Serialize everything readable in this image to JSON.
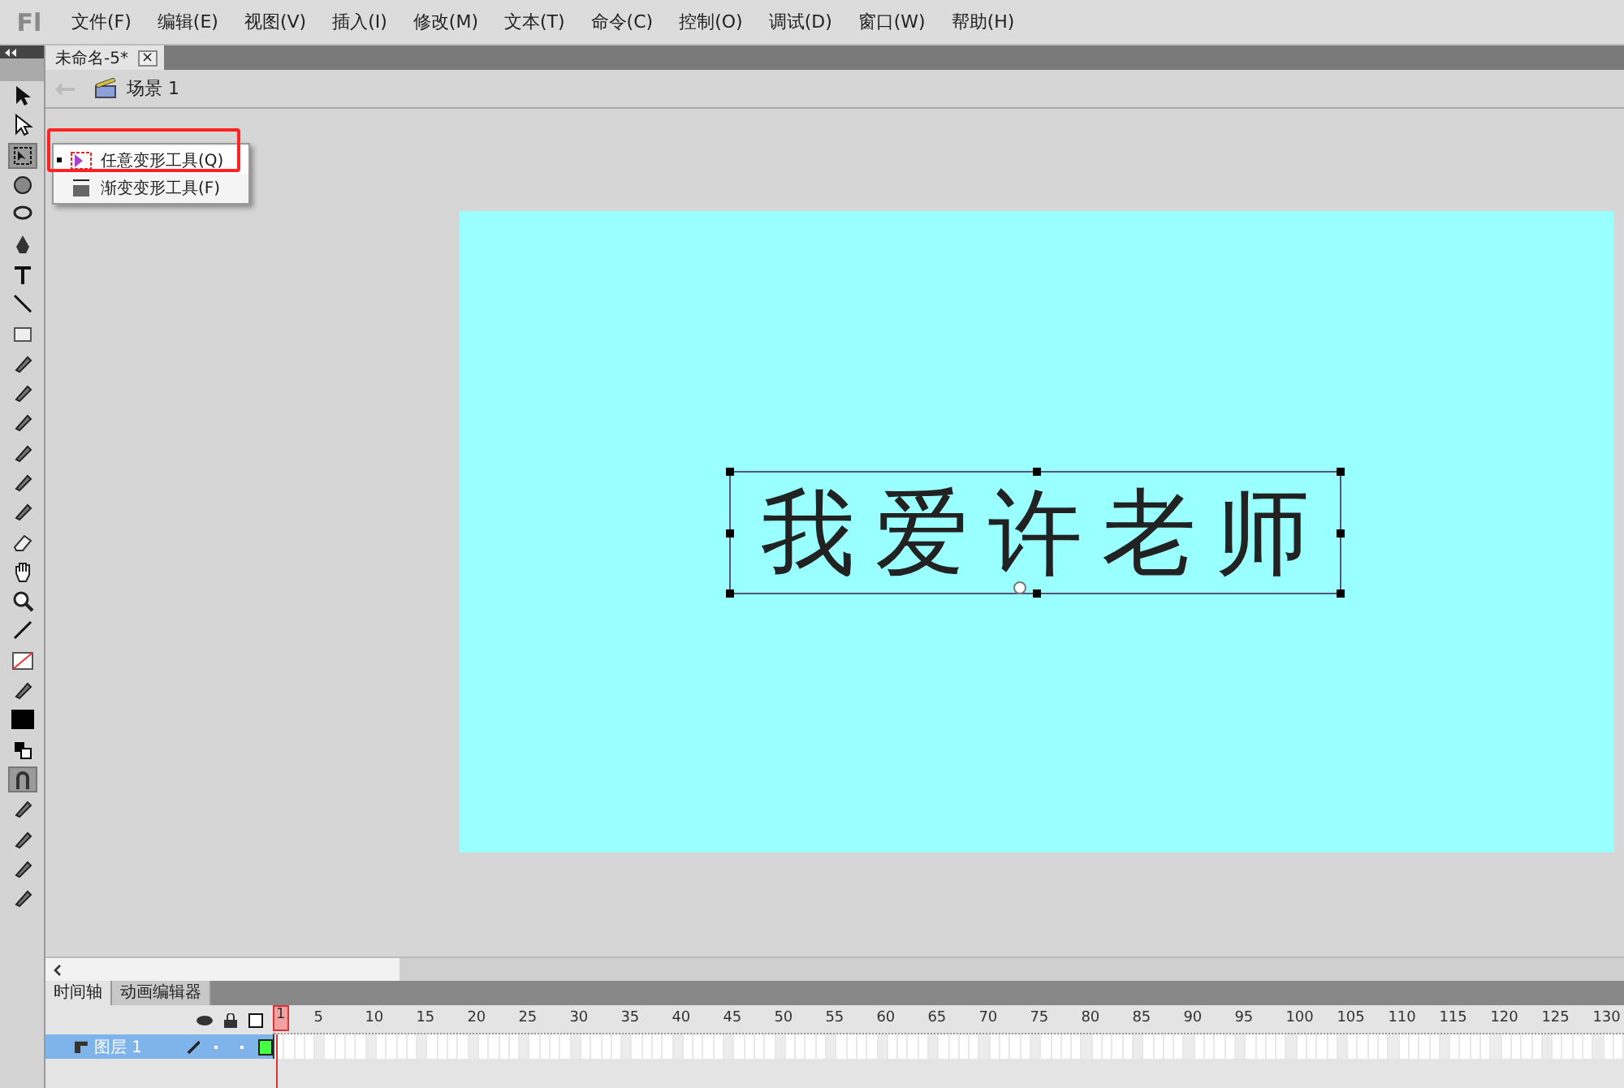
{
  "menu_bar": {
    "logo": "Fl",
    "items": [
      "文件(F)",
      "编辑(E)",
      "视图(V)",
      "插入(I)",
      "修改(M)",
      "文本(T)",
      "命令(C)",
      "控制(O)",
      "调试(D)",
      "窗口(W)",
      "帮助(H)"
    ]
  },
  "document_tab": {
    "title": "未命名-5*",
    "close": "×"
  },
  "breadcrumb": {
    "scene": "场景 1"
  },
  "tools": [
    {
      "selected": false
    },
    {
      "selected": false
    },
    {
      "selected": true
    },
    {
      "selected": false
    },
    {
      "selected": false
    },
    {
      "selected": false
    },
    {
      "selected": false
    },
    {
      "selected": false
    },
    {
      "selected": false
    },
    {
      "selected": false
    },
    {
      "selected": false
    },
    {
      "selected": false
    },
    {
      "selected": false
    },
    {
      "selected": false
    },
    {
      "selected": false
    },
    {
      "selected": false
    },
    {
      "selected": false
    },
    {
      "selected": false
    },
    {
      "selected": false
    },
    {
      "selected": false
    },
    {
      "selected": false
    },
    {
      "selected": false
    },
    {
      "selected": false
    },
    {
      "selected": true
    },
    {
      "selected": false
    },
    {
      "selected": false
    },
    {
      "selected": false
    },
    {
      "selected": false
    }
  ],
  "tool_flyout": {
    "items": [
      {
        "label": "任意变形工具(Q)",
        "selected": true
      },
      {
        "label": "渐变变形工具(F)",
        "selected": false
      }
    ]
  },
  "stage": {
    "text": "我爱许老师"
  },
  "timeline": {
    "tabs": [
      {
        "label": "时间轴",
        "selected": true
      },
      {
        "label": "动画编辑器",
        "selected": false
      }
    ],
    "frame_numbers": [
      "1",
      "5",
      "10",
      "15",
      "20",
      "25",
      "30",
      "35",
      "40",
      "45",
      "50",
      "55",
      "60",
      "65",
      "70",
      "75",
      "80",
      "85",
      "90",
      "95",
      "100",
      "105",
      "110",
      "115",
      "120",
      "125",
      "130"
    ],
    "layers": [
      {
        "name": "图层 1",
        "selected": true
      }
    ]
  }
}
